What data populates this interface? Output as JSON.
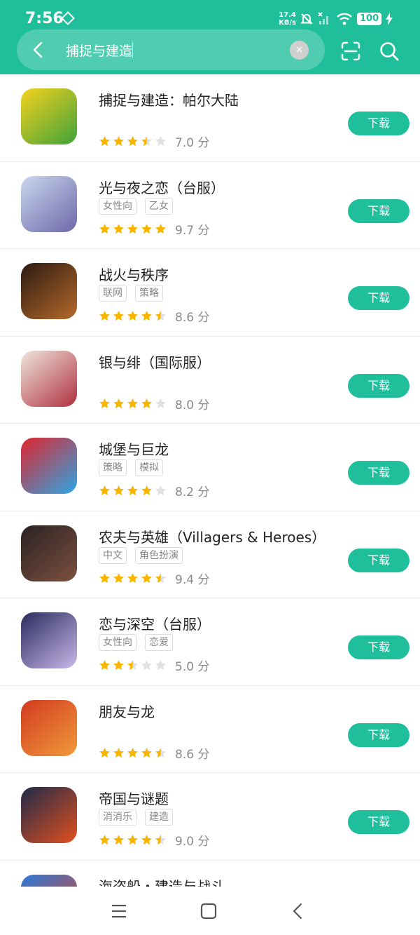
{
  "status_bar": {
    "time": "7:56",
    "net_speed_value": "17.4",
    "net_speed_unit": "KB/s",
    "battery": "100"
  },
  "search": {
    "query": "捕捉与建造",
    "clear_label": "×"
  },
  "download_label": "下载",
  "score_unit": "分",
  "apps": [
    {
      "name": "捕捉与建造：帕尔大陆",
      "tags": [],
      "stars": 3.5,
      "score": "7.0",
      "icon_colors": [
        "#f5d21e",
        "#3fa23a"
      ]
    },
    {
      "name": "光与夜之恋（台服）",
      "tags": [
        "女性向",
        "乙女"
      ],
      "stars": 5,
      "score": "9.7",
      "icon_colors": [
        "#c9d7ee",
        "#6e68a8"
      ]
    },
    {
      "name": "战火与秩序",
      "tags": [
        "联网",
        "策略"
      ],
      "stars": 4.5,
      "score": "8.6",
      "icon_colors": [
        "#2c1a12",
        "#b56a2a"
      ]
    },
    {
      "name": "银与绯（国际服）",
      "tags": [],
      "stars": 4,
      "score": "8.0",
      "icon_colors": [
        "#efe6dc",
        "#b03040"
      ]
    },
    {
      "name": "城堡与巨龙",
      "tags": [
        "策略",
        "模拟"
      ],
      "stars": 4,
      "score": "8.2",
      "icon_colors": [
        "#e0242b",
        "#2da6e6"
      ]
    },
    {
      "name": "农夫与英雄（Villagers & Heroes）",
      "tags": [
        "中文",
        "角色扮演"
      ],
      "stars": 4.5,
      "score": "9.4",
      "icon_colors": [
        "#2a2222",
        "#7d5040"
      ]
    },
    {
      "name": "恋与深空（台服）",
      "tags": [
        "女性向",
        "恋爱"
      ],
      "stars": 2.5,
      "score": "5.0",
      "icon_colors": [
        "#2b2b5e",
        "#c8b8e8"
      ]
    },
    {
      "name": "朋友与龙",
      "tags": [],
      "stars": 4.5,
      "score": "8.6",
      "icon_colors": [
        "#d23a20",
        "#f09a3a"
      ]
    },
    {
      "name": "帝国与谜题",
      "tags": [
        "消消乐",
        "建造"
      ],
      "stars": 4.5,
      "score": "9.0",
      "icon_colors": [
        "#1e2a4a",
        "#e2501e"
      ]
    },
    {
      "name": "海盗船・建造与战斗",
      "tags": [],
      "stars": 0,
      "score": "",
      "icon_colors": [
        "#2a7bd8",
        "#e0402a"
      ]
    }
  ],
  "colors": {
    "accent": "#1fbf9c",
    "star_filled": "#f7b500",
    "star_empty": "#e0e0e0"
  },
  "nav": {
    "menu_icon": "menu-icon",
    "home_icon": "home-icon",
    "back_icon": "back-icon"
  }
}
